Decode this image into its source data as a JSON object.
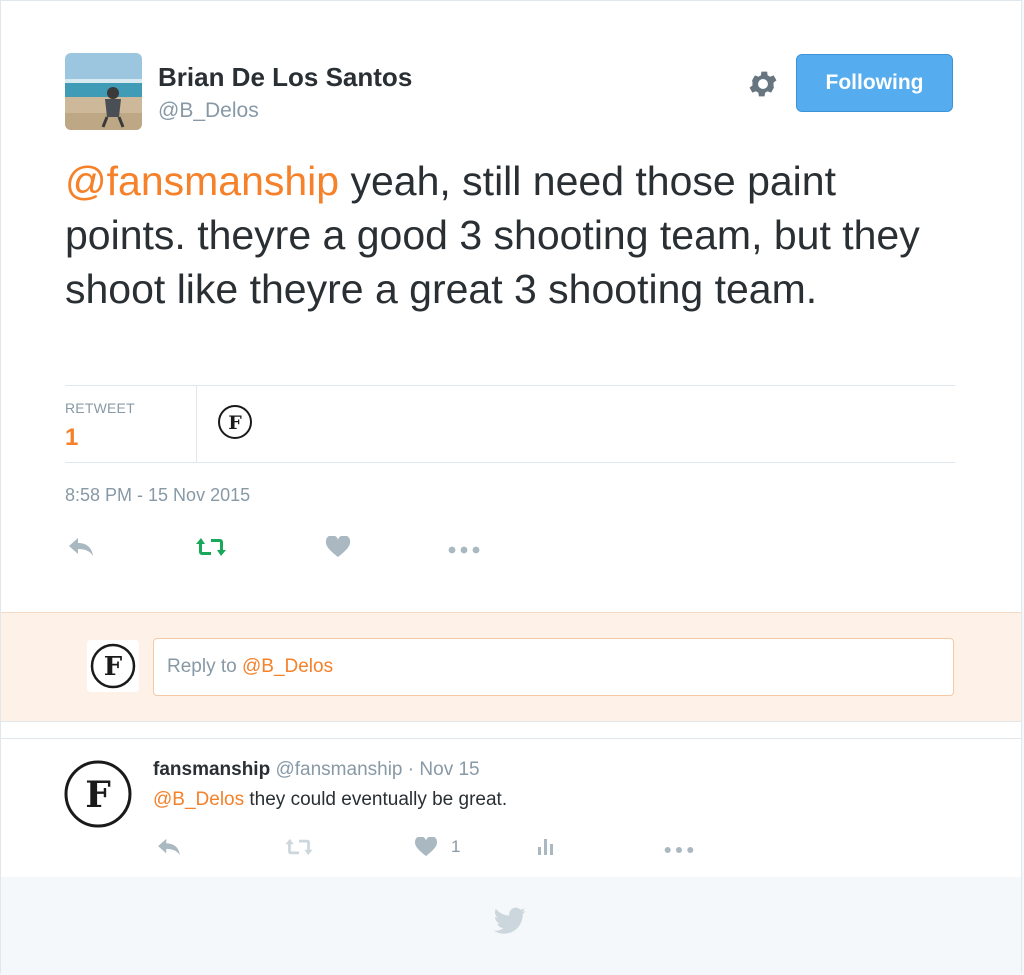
{
  "tweet": {
    "author_name": "Brian De Los Santos",
    "author_handle": "@B_Delos",
    "follow_button_label": "Following",
    "text_mention": "@fansmanship",
    "text_body": " yeah, still need those paint points. theyre a good 3 shooting team, but they shoot like theyre a great 3 shooting team.",
    "retweet_label": "RETWEET",
    "retweet_count": "1",
    "timestamp": "8:58 PM - 15 Nov 2015",
    "actions": [
      "reply-icon",
      "retweet-icon",
      "heart-icon",
      "more-icon"
    ]
  },
  "reply_box": {
    "prefix": "Reply to ",
    "mention": "@B_Delos"
  },
  "reply_tweet": {
    "author_name": "fansmanship",
    "author_handle": "@fansmanship",
    "separator": "·",
    "date": "Nov 15",
    "text_mention": "@B_Delos",
    "text_body": " they could eventually be great.",
    "like_count": "1",
    "actions": [
      "reply-icon",
      "retweet-icon",
      "heart-icon",
      "analytics-icon",
      "more-icon"
    ]
  },
  "colors": {
    "accent_orange": "#f5812a",
    "follow_blue": "#55acee",
    "retweet_green": "#19cf86",
    "muted_gray": "#8899a6",
    "icon_gray": "#aab8c2"
  }
}
